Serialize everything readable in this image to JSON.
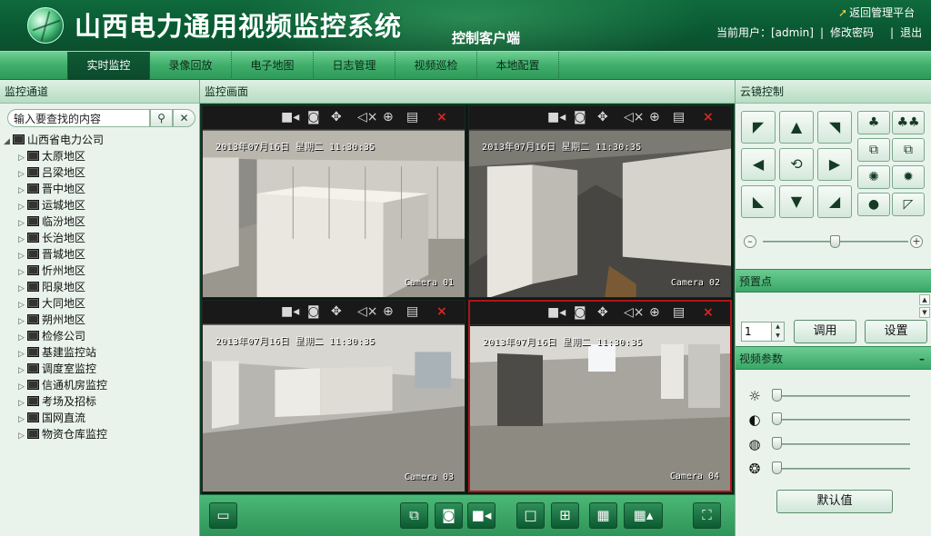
{
  "header": {
    "title": "山西电力通用视频监控系统",
    "subtitle": "控制客户端",
    "return_link": "返回管理平台",
    "user_label": "当前用户：[admin]",
    "sep": "|",
    "change_pwd": "修改密码",
    "logout": "退出"
  },
  "nav": {
    "tabs": [
      "实时监控",
      "录像回放",
      "电子地图",
      "日志管理",
      "视频巡检",
      "本地配置"
    ],
    "active": "实时监控"
  },
  "left": {
    "title": "监控通道",
    "search_placeholder": "输入要查找的内容",
    "search_icon": "search-icon",
    "clear_icon": "clear-icon",
    "root": "山西省电力公司",
    "items": [
      "太原地区",
      "吕梁地区",
      "晋中地区",
      "运城地区",
      "临汾地区",
      "长治地区",
      "晋城地区",
      "忻州地区",
      "阳泉地区",
      "大同地区",
      "朔州地区",
      "检修公司",
      "基建监控站",
      "调度室监控",
      "信通机房监控",
      "考场及招标",
      "国网直流",
      "物资仓库监控"
    ]
  },
  "video": {
    "title": "监控画面",
    "cells": [
      {
        "timestamp": "2013年07月16日 星期二 11:30:35",
        "camera": "Camera 01"
      },
      {
        "timestamp": "2013年07月16日 星期二 11:30:35",
        "camera": "Camera 02"
      },
      {
        "timestamp": "2013年07月16日 星期二 11:30:35",
        "camera": "Camera 03"
      },
      {
        "timestamp": "2013年07月16日 星期二 11:30:35",
        "camera": "Camera 04"
      }
    ],
    "selected_cell": 4,
    "cell_toolbar_icons": [
      "record-icon",
      "snapshot-icon",
      "ptz-icon",
      "mute-icon",
      "zoom-in-icon",
      "stream-icon",
      "close-icon"
    ]
  },
  "bottom_toolbar": {
    "buttons": [
      "screen-icon",
      "close-all-icon",
      "snapshot-icon",
      "record-icon",
      "layout-1-icon",
      "layout-4-icon",
      "layout-9-icon",
      "layout-16-icon",
      "fullscreen-icon"
    ]
  },
  "right": {
    "ptz_title": "云镜控制",
    "preset_title": "预置点",
    "preset_value": "1",
    "call_button": "调用",
    "set_button": "设置",
    "video_params_title": "视频参数",
    "collapse_symbol": "–",
    "default_button": "默认值",
    "params": [
      {
        "name": "brightness",
        "icon": "brightness-icon",
        "value": 0
      },
      {
        "name": "contrast",
        "icon": "contrast-icon",
        "value": 0
      },
      {
        "name": "saturation",
        "icon": "saturation-icon",
        "value": 0
      },
      {
        "name": "hue",
        "icon": "hue-icon",
        "value": 0
      }
    ],
    "speed_slider_value": 0.5
  },
  "colors": {
    "header": "#0a5a33",
    "nav": "#3fae6b",
    "active_tab": "#0f5a35",
    "selection": "#b3131b"
  }
}
